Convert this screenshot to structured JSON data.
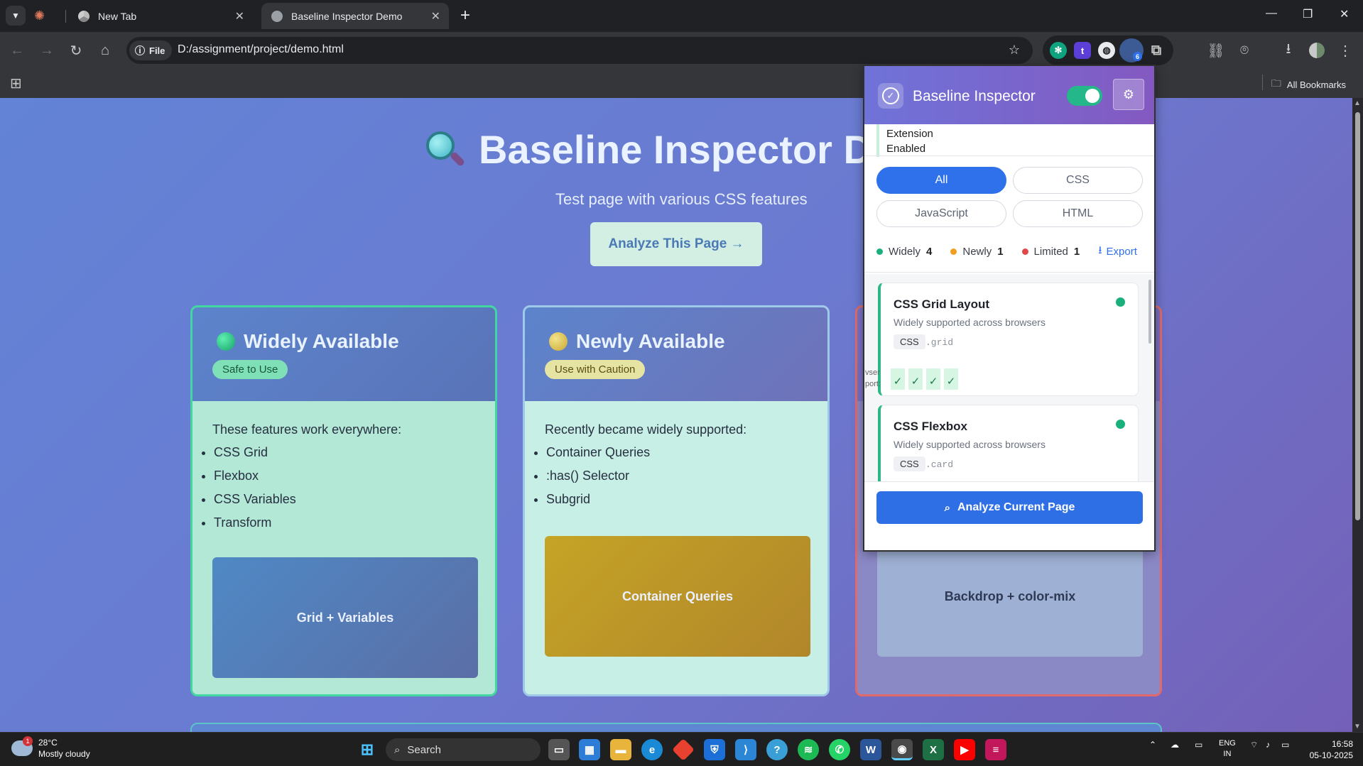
{
  "browser": {
    "tabs": [
      {
        "label": ""
      },
      {
        "label": "New Tab",
        "close": "✕"
      },
      {
        "label": "Baseline Inspector Demo",
        "close": "✕"
      }
    ],
    "new_tab": "+",
    "url_chip": "File",
    "url": "D:/assignment/project/demo.html",
    "all_bookmarks": "All Bookmarks",
    "extension_badge": "6"
  },
  "page": {
    "title": "Baseline Inspector De",
    "subtitle": "Test page with various CSS features",
    "analyze_button": "Analyze This Page →",
    "cards": [
      {
        "title": "Widely Available",
        "badge": "Safe to Use",
        "intro": "These features work everywhere:",
        "items": [
          "CSS Grid",
          "Flexbox",
          "CSS Variables",
          "Transform"
        ],
        "demo": "Grid + Variables"
      },
      {
        "title": "Newly Available",
        "badge": "Use with Caution",
        "intro": "Recently became widely supported:",
        "items": [
          "Container Queries",
          ":has() Selector",
          "Subgrid"
        ],
        "demo": "Container Queries"
      },
      {
        "title": "",
        "demo": "Backdrop + color-mix"
      }
    ]
  },
  "popup": {
    "title": "Baseline Inspector",
    "toggle_on": true,
    "status_line1": "Extension",
    "status_line2": "Enabled",
    "filters": [
      "All",
      "CSS",
      "JavaScript",
      "HTML"
    ],
    "selected_filter": "All",
    "stats": [
      {
        "label": "Widely",
        "count": "4",
        "color": "#19b07c"
      },
      {
        "label": "Newly",
        "count": "1",
        "color": "#f0a020"
      },
      {
        "label": "Limited",
        "count": "1",
        "color": "#e04848"
      }
    ],
    "export": "Export",
    "features": [
      {
        "name": "CSS Grid Layout",
        "desc": "Widely supported across browsers",
        "tag": "CSS",
        "selector": ".grid",
        "support_label_1": "vser",
        "support_label_2": "port:",
        "checks": [
          "✓",
          "✓",
          "✓",
          "✓"
        ]
      },
      {
        "name": "CSS Flexbox",
        "desc": "Widely supported across browsers",
        "tag": "CSS",
        "selector": ".card"
      }
    ],
    "analyze_button": "Analyze Current Page"
  },
  "taskbar": {
    "weather_temp": "28°C",
    "weather_desc": "Mostly cloudy",
    "weather_badge": "1",
    "search": "Search",
    "lang1": "ENG",
    "lang2": "IN",
    "time": "16:58",
    "date": "05-10-2025"
  }
}
